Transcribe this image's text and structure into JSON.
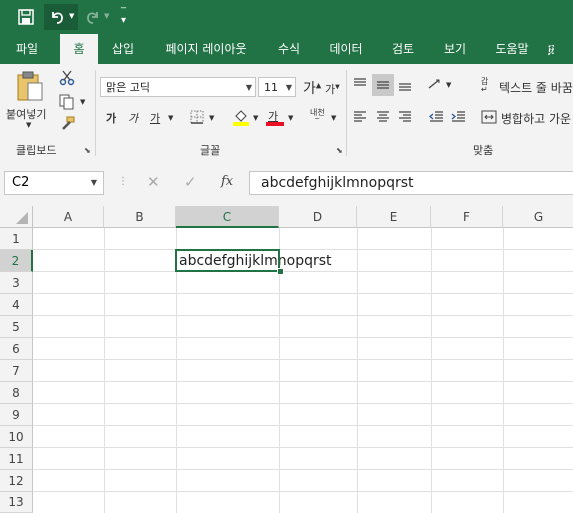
{
  "ribbon_tabs": [
    "파일",
    "홈",
    "삽입",
    "페이지 레이아웃",
    "수식",
    "데이터",
    "검토",
    "보기",
    "도움말",
    "፱"
  ],
  "active_tab": "홈",
  "clipboard": {
    "paste_label": "붙여넣기",
    "group_label": "클립보드"
  },
  "font": {
    "name": "맑은 고딕",
    "size": "11",
    "grow": "가",
    "shrink": "가",
    "bold": "가",
    "italic": "가",
    "underline": "가",
    "font_color_char": "가",
    "group_label": "글꼴"
  },
  "alignment": {
    "wrap_text": "텍스트 줄 바꿈",
    "merge_center": "병합하고 가운",
    "group_label": "맞춤"
  },
  "formula_bar": {
    "name_box": "C2",
    "fx": "fx",
    "content": "abcdefghijklmnopqrst"
  },
  "columns": [
    "A",
    "B",
    "C",
    "D",
    "E",
    "F",
    "G"
  ],
  "selected_column": "C",
  "rows": [
    "1",
    "2",
    "3",
    "4",
    "5",
    "6",
    "7",
    "8",
    "9",
    "10",
    "11",
    "12",
    "13"
  ],
  "selected_row": "2",
  "cells": {
    "C2": "abcdefghijklmnopqrst"
  },
  "colors": {
    "excel_green": "#217346",
    "font_underline_red": "#e81123",
    "highlight_yellow": "#ffff00"
  }
}
